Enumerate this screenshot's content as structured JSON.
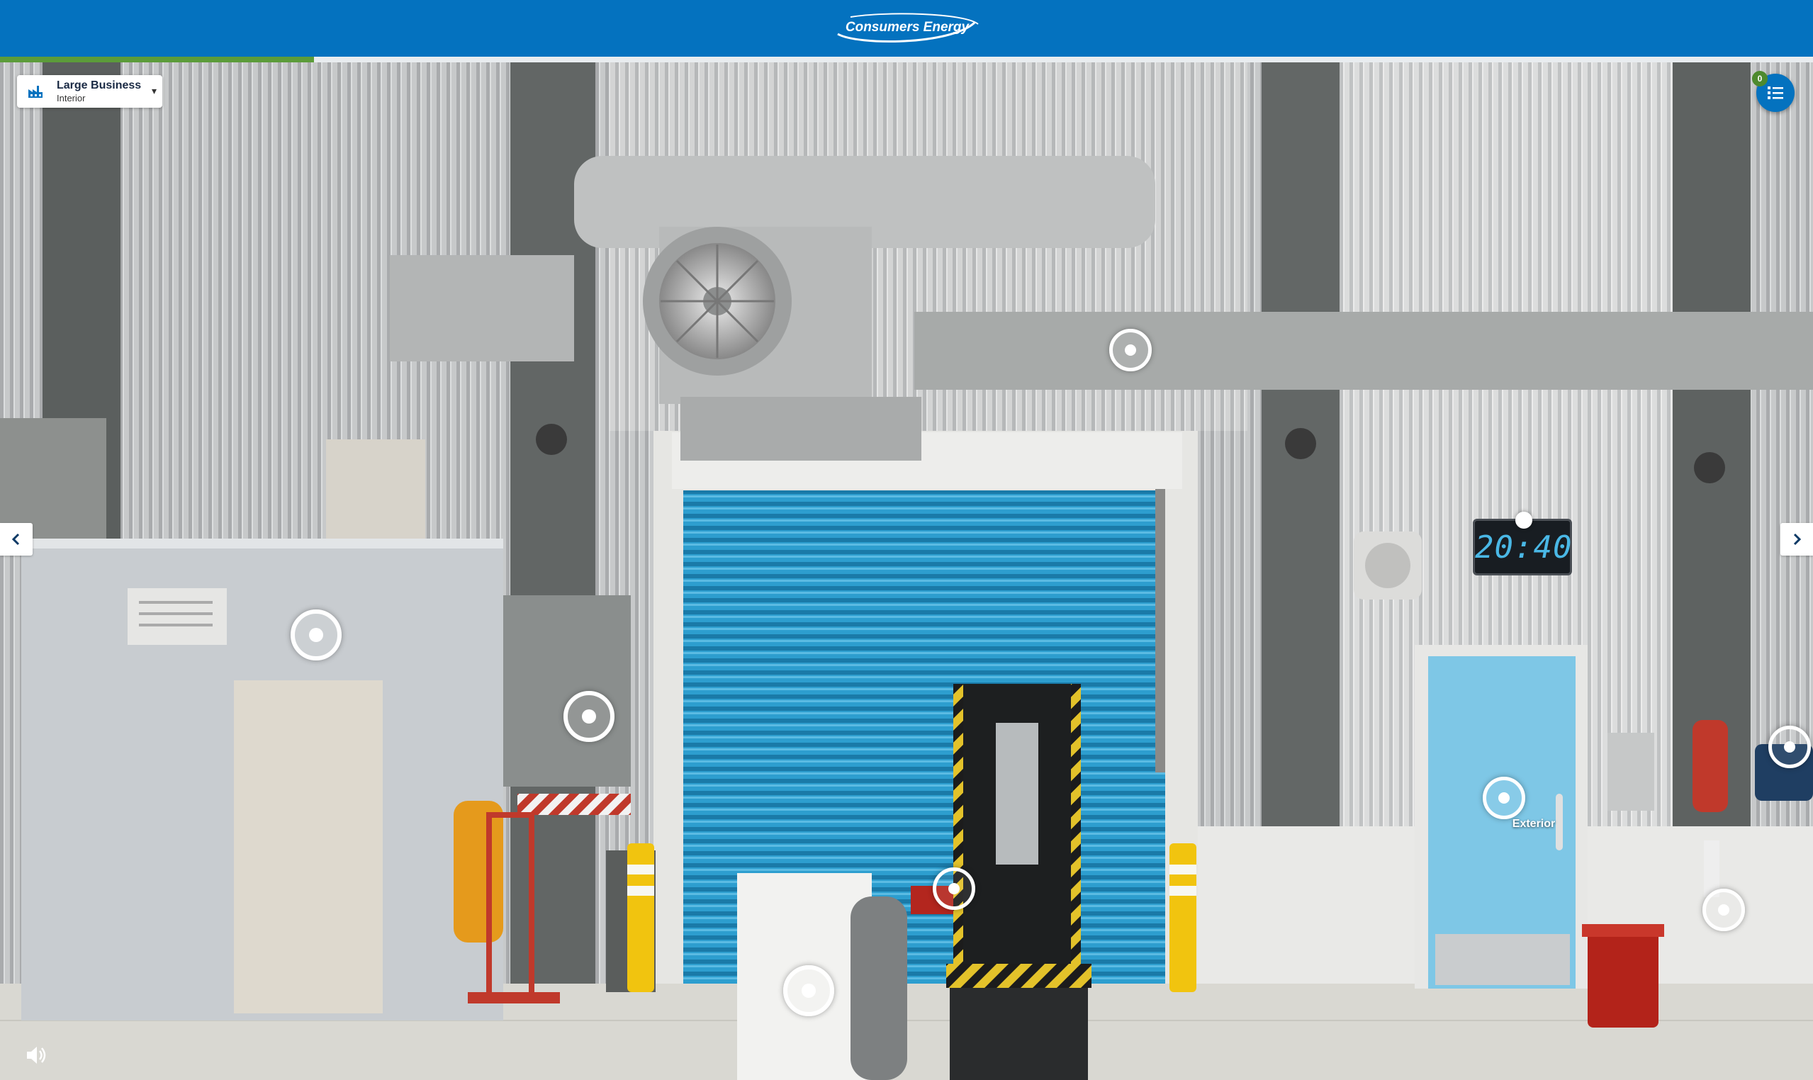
{
  "header": {
    "brand": "Consumers Energy",
    "brand_color": "#0472bf"
  },
  "progress": {
    "percent": 17.3,
    "color": "#5c9c3a"
  },
  "location_selector": {
    "title": "Large Business",
    "subtitle": "Interior",
    "icon": "factory-icon",
    "caret": "▾"
  },
  "list_button": {
    "count": "0",
    "icon": "list-icon"
  },
  "navigation": {
    "prev_icon": "chevron-left-icon",
    "next_icon": "chevron-right-icon"
  },
  "clock": {
    "time": "20:40"
  },
  "hotspots": {
    "exterior_label": "Exterior"
  },
  "sound": {
    "icon": "speaker-icon"
  }
}
